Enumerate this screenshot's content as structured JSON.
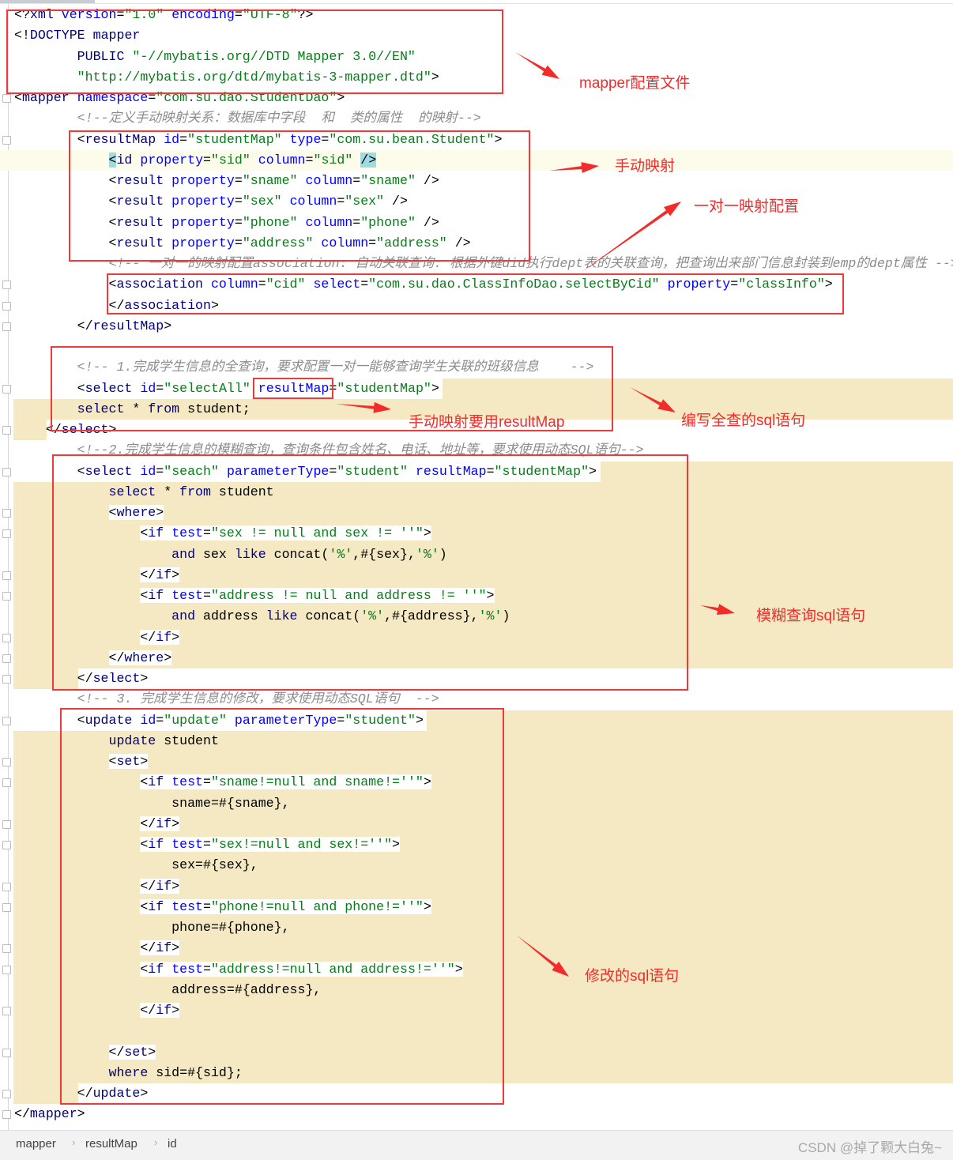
{
  "editor": {
    "lines": [
      "<?xml version=\"1.0\" encoding=\"UTF-8\"?>",
      "<!DOCTYPE mapper",
      "        PUBLIC \"-//mybatis.org//DTD Mapper 3.0//EN\"",
      "        \"http://mybatis.org/dtd/mybatis-3-mapper.dtd\">",
      "<mapper namespace=\"com.su.dao.StudentDao\">",
      "        <!--定义手动映射关系：数据库中字段  和  类的属性  的映射-->",
      "        <resultMap id=\"studentMap\" type=\"com.su.bean.Student\">",
      "            <id property=\"sid\" column=\"sid\" />",
      "            <result property=\"sname\" column=\"sname\" />",
      "            <result property=\"sex\" column=\"sex\" />",
      "            <result property=\"phone\" column=\"phone\" />",
      "            <result property=\"address\" column=\"address\" />",
      "            <!-- 一对一的映射配置association: 自动关联查询: 根据外键did执行dept表的关联查询，把查询出来部门信息封装到emp的dept属性 -->",
      "            <association column=\"cid\" select=\"com.su.dao.ClassInfoDao.selectByCid\" property=\"classInfo\">",
      "            </association>",
      "        </resultMap>",
      "",
      "        <!-- 1.完成学生信息的全查询，要求配置一对一能够查询学生关联的班级信息    -->",
      "        <select id=\"selectAll\" resultMap=\"studentMap\">",
      "        select * from student;",
      "    </select>",
      "        <!--2.完成学生信息的模糊查询，查询条件包含姓名、电话、地址等，要求使用动态SQL语句-->",
      "        <select id=\"seach\" parameterType=\"student\" resultMap=\"studentMap\">",
      "            select * from student",
      "            <where>",
      "                <if test=\"sex != null and sex != ''\">",
      "                    and sex like concat('%',#{sex},'%')",
      "                </if>",
      "                <if test=\"address != null and address != ''\">",
      "                    and address like concat('%',#{address},'%')",
      "                </if>",
      "            </where>",
      "        </select>",
      "        <!-- 3. 完成学生信息的修改，要求使用动态SQL语句  -->",
      "        <update id=\"update\" parameterType=\"student\">",
      "            update student",
      "            <set>",
      "                <if test=\"sname!=null and sname!=''\">",
      "                    sname=#{sname},",
      "                </if>",
      "                <if test=\"sex!=null and sex!=''\">",
      "                    sex=#{sex},",
      "                </if>",
      "                <if test=\"phone!=null and phone!=''\">",
      "                    phone=#{phone},",
      "                </if>",
      "                <if test=\"address!=null and address!=''\">",
      "                    address=#{address},",
      "                </if>",
      "",
      "            </set>",
      "            where sid=#{sid};",
      "        </update>",
      "</mapper>"
    ],
    "sql_keywords": [
      "select",
      "from",
      "and",
      "like",
      "update",
      "where"
    ]
  },
  "annotations": {
    "color": "#f22b2b",
    "labels": [
      "mapper配置文件",
      "手动映射",
      "一对一映射配置",
      "手动映射要用resultMap",
      "编写全查的sql语句",
      "模糊查询sql语句",
      "修改的sql语句"
    ]
  },
  "status_bar": {
    "breadcrumb": [
      "mapper",
      "resultMap",
      "id"
    ],
    "watermark": "CSDN @掉了颗大白兔~"
  }
}
